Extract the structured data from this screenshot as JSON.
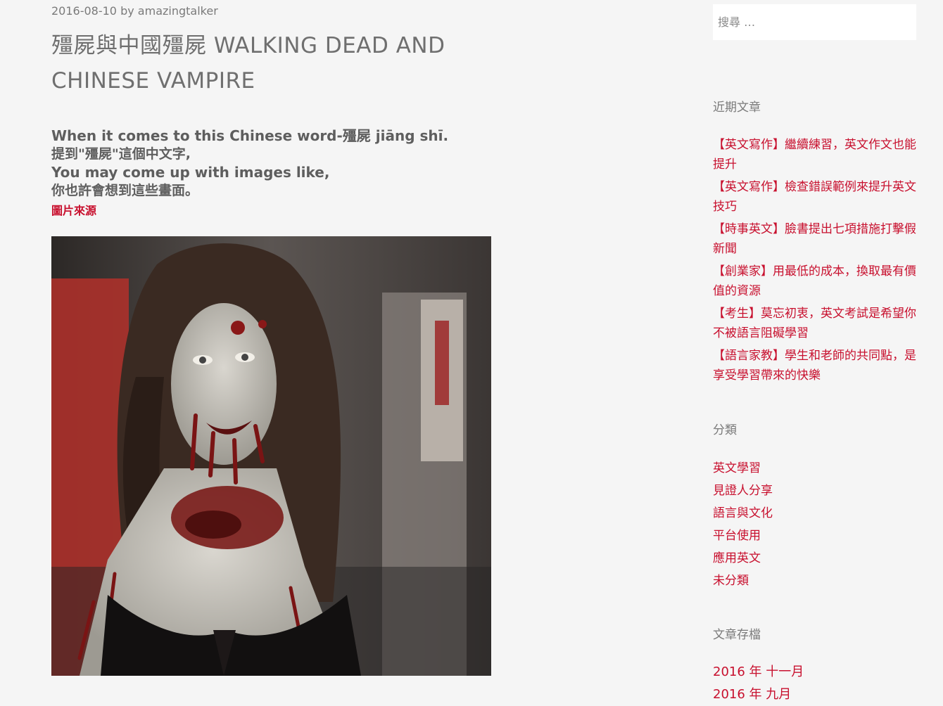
{
  "post": {
    "date": "2016-08-10",
    "by": "by",
    "author": "amazingtalker",
    "title": "殭屍與中國殭屍 WALKING DEAD AND CHINESE VAMPIRE",
    "intro_lines": [
      "When it comes to this Chinese word-殭屍 jiāng shī.",
      "提到\"殭屍\"這個中文字,",
      "You may come up with images like,",
      "你也許會想到這些畫面。"
    ],
    "image_source_label": "圖片來源"
  },
  "sidebar": {
    "search_placeholder": "搜尋 …",
    "recent_title": "近期文章",
    "recent_posts": [
      "【英文寫作】繼續練習，英文作文也能提升",
      "【英文寫作】檢查錯誤範例來提升英文技巧",
      "【時事英文】臉書提出七項措施打擊假新聞",
      "【創業家】用最低的成本，換取最有價值的資源",
      "【考生】莫忘初衷，英文考試是希望你不被語言阻礙學習",
      "【語言家教】學生和老師的共同點，是享受學習帶來的快樂"
    ],
    "categories_title": "分類",
    "categories": [
      "英文學習",
      "見證人分享",
      "語言與文化",
      "平台使用",
      "應用英文",
      "未分類"
    ],
    "archives_title": "文章存檔",
    "archives": [
      "2016 年 十一月",
      "2016 年 九月"
    ]
  },
  "colors": {
    "link_red": "#c8102e",
    "background": "#f5f5f5",
    "title_gray": "#6f6f6f"
  }
}
